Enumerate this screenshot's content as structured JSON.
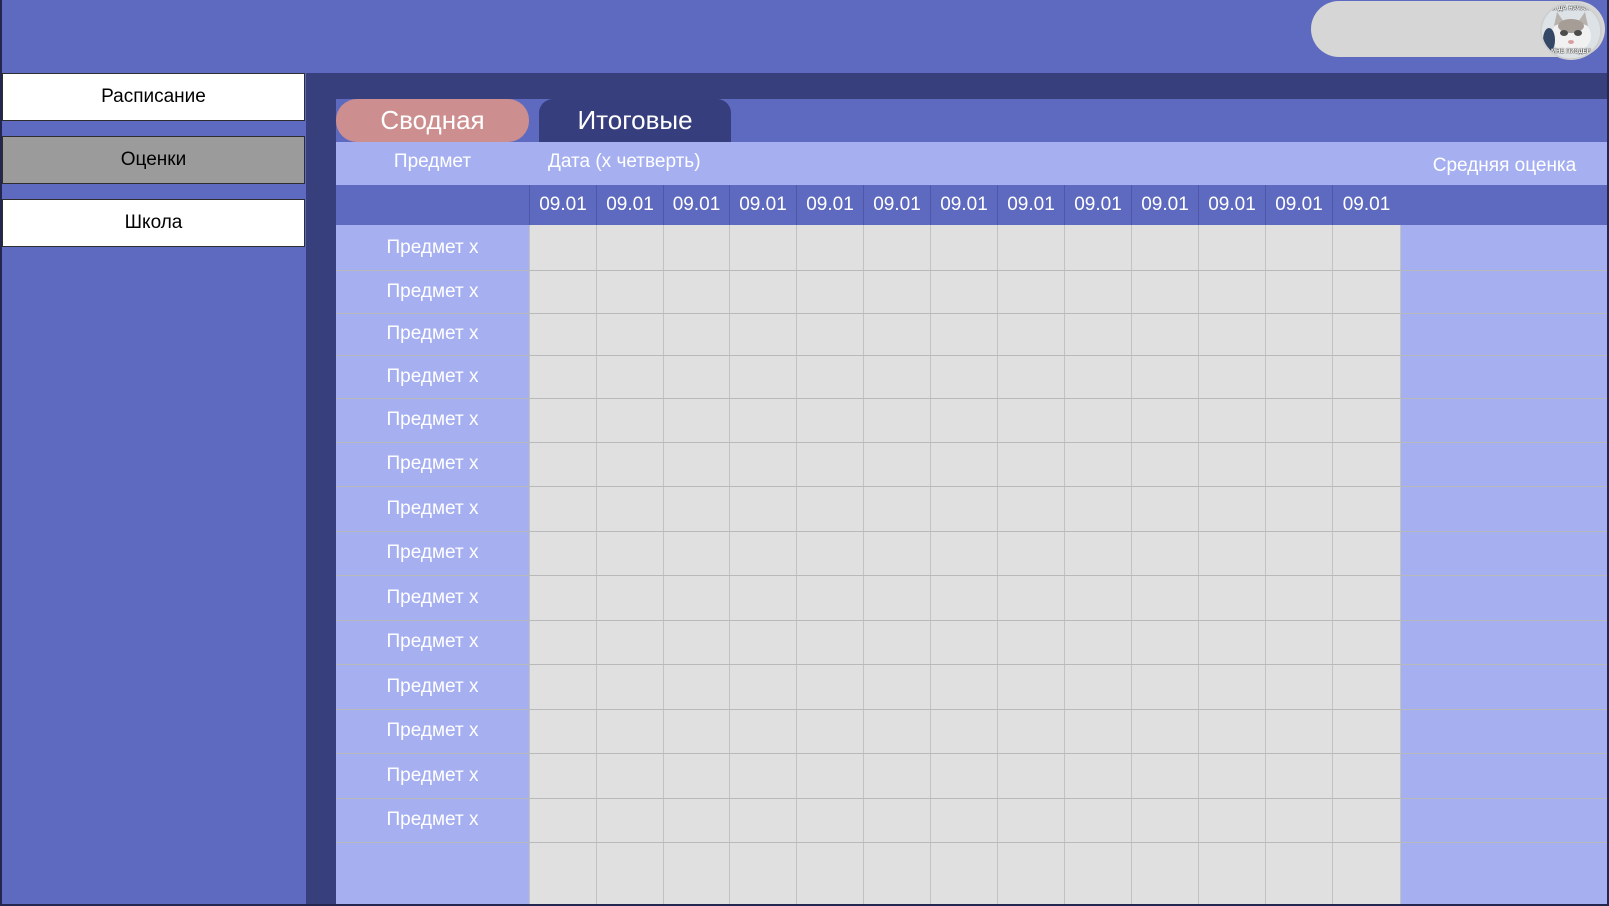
{
  "header": {
    "avatar_caption_top": "КОГДА НАЧАЛ…",
    "avatar_caption_bottom": "МНЕ ПИЗДЕЦ"
  },
  "sidebar": {
    "items": [
      {
        "label": "Расписание",
        "active": false
      },
      {
        "label": "Оценки",
        "active": true
      },
      {
        "label": "Школа",
        "active": false
      }
    ]
  },
  "tabs": [
    {
      "label": "Сводная",
      "active": true
    },
    {
      "label": "Итоговые",
      "active": false
    }
  ],
  "table": {
    "subject_header": "Предмет",
    "date_header": "Дата (х четверть)",
    "avg_header": "Средняя оценка",
    "dates": [
      "09.01",
      "09.01",
      "09.01",
      "09.01",
      "09.01",
      "09.01",
      "09.01",
      "09.01",
      "09.01",
      "09.01",
      "09.01",
      "09.01",
      "09.01"
    ],
    "subjects": [
      "Предмет х",
      "Предмет х",
      "Предмет х",
      "Предмет х",
      "Предмет х",
      "Предмет х",
      "Предмет х",
      "Предмет х",
      "Предмет х",
      "Предмет х",
      "Предмет х",
      "Предмет х",
      "Предмет х",
      "Предмет х"
    ]
  },
  "colors": {
    "background": "#5e6abf",
    "main_dark": "#373f7c",
    "light_column": "#a6b0f1",
    "grid": "#e0e0e0",
    "active_tab": "#cc8e8e",
    "inactive_tab": "#363e7d",
    "user_pill": "#d6d6d6",
    "active_nav": "#9b9b9b"
  },
  "icons": {
    "avatar": "cat-meme-avatar"
  }
}
